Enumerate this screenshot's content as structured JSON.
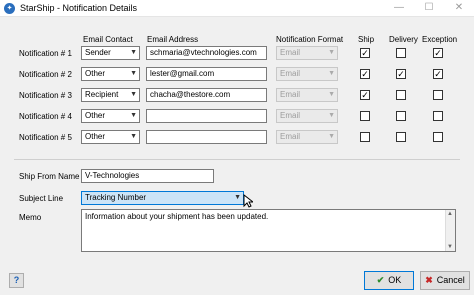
{
  "window": {
    "title": "StarShip - Notification Details",
    "minimize_glyph": "—",
    "maximize_glyph": "☐",
    "close_glyph": "✕"
  },
  "columns": {
    "email_contact": "Email Contact",
    "email_address": "Email Address",
    "notification_format": "Notification Format",
    "ship": "Ship",
    "delivery": "Delivery",
    "exception": "Exception"
  },
  "notifications": [
    {
      "label": "Notification # 1",
      "contact": "Sender",
      "email": "schmaria@vtechnologies.com",
      "format": "Email",
      "ship": true,
      "delivery": false,
      "exception": true
    },
    {
      "label": "Notification # 2",
      "contact": "Other",
      "email": "lester@gmail.com",
      "format": "Email",
      "ship": true,
      "delivery": true,
      "exception": true
    },
    {
      "label": "Notification # 3",
      "contact": "Recipient",
      "email": "chacha@thestore.com",
      "format": "Email",
      "ship": true,
      "delivery": false,
      "exception": false
    },
    {
      "label": "Notification # 4",
      "contact": "Other",
      "email": "",
      "format": "Email",
      "ship": false,
      "delivery": false,
      "exception": false
    },
    {
      "label": "Notification # 5",
      "contact": "Other",
      "email": "",
      "format": "Email",
      "ship": false,
      "delivery": false,
      "exception": false
    }
  ],
  "ship_from": {
    "label": "Ship From Name",
    "value": "V-Technologies"
  },
  "subject": {
    "label": "Subject Line",
    "value": "Tracking Number"
  },
  "memo": {
    "label": "Memo",
    "value": "Information about your shipment has been updated."
  },
  "buttons": {
    "help": "?",
    "ok": "OK",
    "cancel": "Cancel"
  },
  "colors": {
    "focus_blue": "#0078d7",
    "selection_blue": "#cce4f7"
  }
}
